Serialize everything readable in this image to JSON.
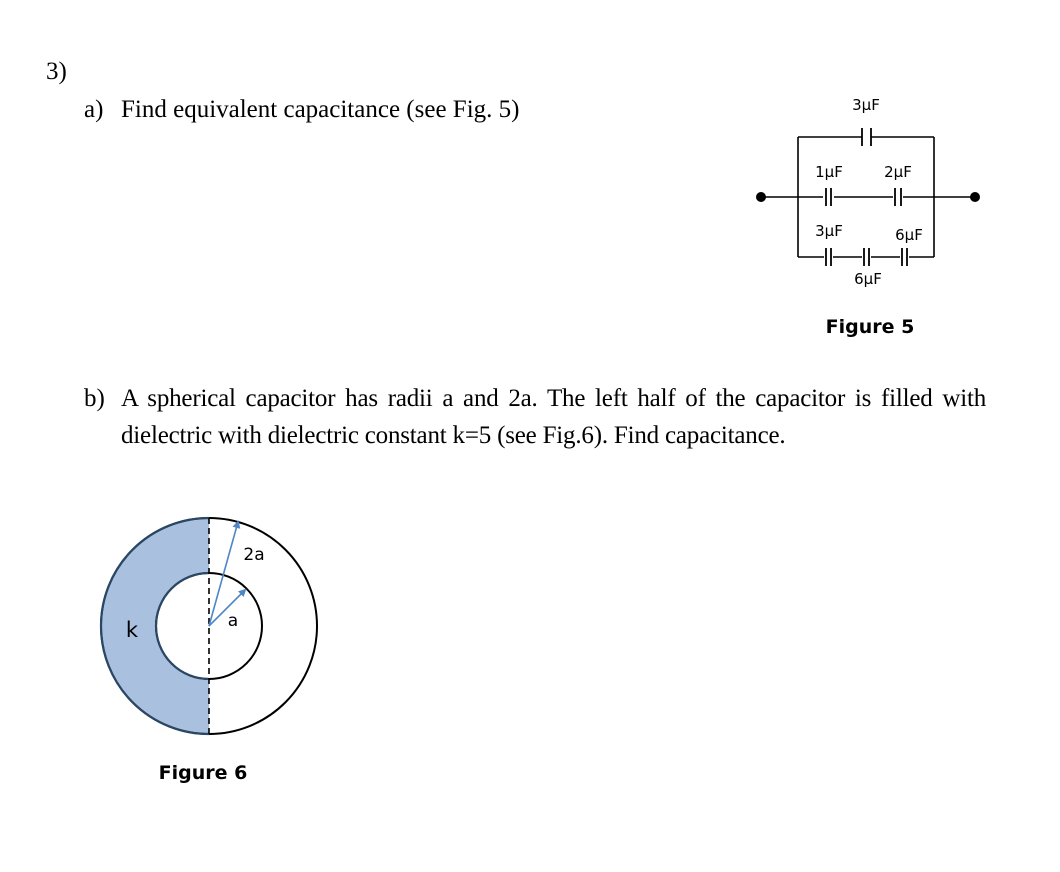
{
  "question": {
    "number": "3)",
    "part_a": {
      "label": "a)",
      "text": "Find equivalent capacitance (see Fig. 5)"
    },
    "part_b": {
      "label": "b)",
      "text": "A spherical capacitor has radii a and 2a. The left half of the capacitor is filled with dielectric with dielectric constant k=5 (see Fig.6). Find capacitance."
    }
  },
  "figure5": {
    "caption": "Figure 5",
    "capacitors": {
      "top": "3μF",
      "middle_left": "1μF",
      "middle_right": "2μF",
      "bottom_left": "3μF",
      "bottom_middle": "6μF",
      "bottom_right": "6μF"
    }
  },
  "figure6": {
    "caption": "Figure 6",
    "dielectric_label": "k",
    "outer_radius_label": "2a",
    "inner_radius_label": "a",
    "dielectric_color": "#a9c0df",
    "arrow_color": "#4f86c6"
  }
}
